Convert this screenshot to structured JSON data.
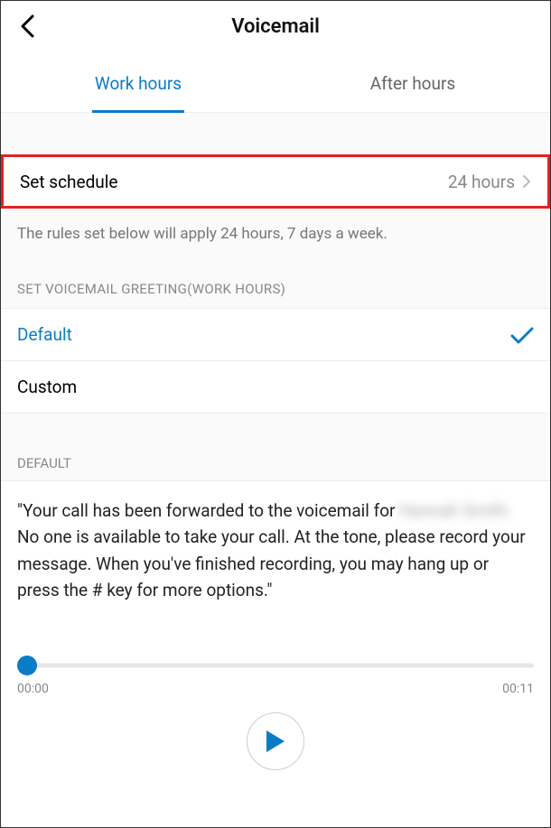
{
  "header": {
    "title": "Voicemail"
  },
  "tabs": {
    "work_hours": "Work hours",
    "after_hours": "After hours"
  },
  "schedule": {
    "label": "Set schedule",
    "value": "24 hours"
  },
  "description": "The rules set below will apply 24 hours, 7 days a week.",
  "greeting_section": {
    "header": "SET VOICEMAIL GREETING(WORK HOURS)",
    "default_label": "Default",
    "custom_label": "Custom"
  },
  "default_playback": {
    "header": "DEFAULT",
    "message_part1": "\"Your call has been forwarded to the voicemail for ",
    "redacted1": "Hannah",
    "redacted2": "Smith.",
    "message_part2": " No one is available to take your call. At the tone, please record your message. When you've finished recording, you may hang up or press the # key for more options.\""
  },
  "player": {
    "current": "00:00",
    "total": "00:11"
  }
}
